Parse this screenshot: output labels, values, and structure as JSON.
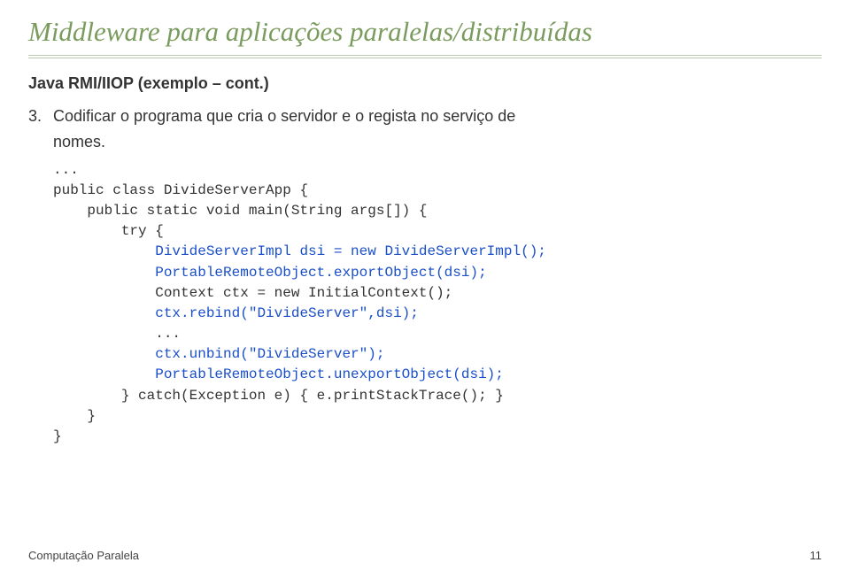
{
  "title": "Middleware para aplicações paralelas/distribuídas",
  "heading": "Java RMI/IIOP (exemplo – cont.)",
  "step_num": "3.",
  "step_text_line1": "Codificar o programa que cria o servidor e o regista no serviço de",
  "step_text_line2": "nomes.",
  "code": {
    "l0": "...",
    "l1": "public class DivideServerApp {",
    "l2": "    public static void main(String args[]) {",
    "l3": "        try {",
    "l4a": "            ",
    "l4b": "DivideServerImpl dsi = new DivideServerImpl();",
    "l5a": "            ",
    "l5b": "PortableRemoteObject.exportObject(dsi);",
    "l6": "            Context ctx = new InitialContext();",
    "l7a": "            ",
    "l7b": "ctx.rebind(\"DivideServer\",dsi);",
    "l8": "            ...",
    "l9a": "            ",
    "l9b": "ctx.unbind(\"DivideServer\");",
    "l10a": "            ",
    "l10b": "PortableRemoteObject.unexportObject(dsi);",
    "l11": "        } catch(Exception e) { e.printStackTrace(); }",
    "l12": "    }",
    "l13": "}"
  },
  "footer_left": "Computação Paralela",
  "footer_right": "11"
}
